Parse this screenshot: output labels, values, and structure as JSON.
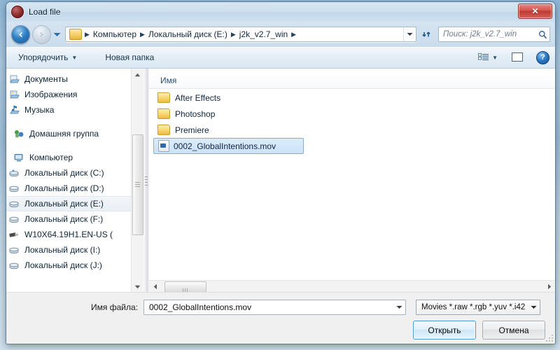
{
  "window": {
    "title": "Load file",
    "app_icon": "record-circle-icon",
    "close_label": "✕"
  },
  "nav": {
    "back_tooltip": "Назад",
    "forward_tooltip": "Вперед",
    "recent_tooltip": "Последние страницы",
    "breadcrumbs": [
      "Компьютер",
      "Локальный диск (E:)",
      "j2k_v2.7_win"
    ],
    "refresh_tooltip": "Обновить",
    "search_placeholder": "Поиск: j2k_v2.7_win"
  },
  "toolbar": {
    "organize_label": "Упорядочить",
    "new_folder_label": "Новая папка",
    "view_tooltip": "Изменить представление",
    "preview_tooltip": "Область предварительного просмотра",
    "help_label": "?"
  },
  "sidebar": {
    "items": [
      {
        "label": "Документы",
        "icon": "document-library-icon",
        "type": "library",
        "selected": false
      },
      {
        "label": "Изображения",
        "icon": "pictures-library-icon",
        "type": "library",
        "selected": false
      },
      {
        "label": "Музыка",
        "icon": "music-library-icon",
        "type": "library",
        "selected": false
      },
      {
        "label": "Домашняя группа",
        "icon": "homegroup-icon",
        "type": "group",
        "selected": false
      },
      {
        "label": "Компьютер",
        "icon": "computer-icon",
        "type": "group",
        "selected": false
      },
      {
        "label": "Локальный диск (C:)",
        "icon": "system-drive-icon",
        "type": "drive",
        "selected": false
      },
      {
        "label": "Локальный диск (D:)",
        "icon": "drive-icon",
        "type": "drive",
        "selected": false
      },
      {
        "label": "Локальный диск (E:)",
        "icon": "drive-icon",
        "type": "drive",
        "selected": true
      },
      {
        "label": "Локальный диск (F:)",
        "icon": "drive-icon",
        "type": "drive",
        "selected": false
      },
      {
        "label": "W10X64.19H1.EN-US (",
        "icon": "usb-drive-icon",
        "type": "drive",
        "selected": false
      },
      {
        "label": "Локальный диск (I:)",
        "icon": "drive-icon",
        "type": "drive",
        "selected": false
      },
      {
        "label": "Локальный диск (J:)",
        "icon": "drive-icon",
        "type": "drive",
        "selected": false
      }
    ]
  },
  "filelist": {
    "column_header": "Имя",
    "sort_direction": "ascending",
    "rows": [
      {
        "name": "After Effects",
        "icon": "folder-icon",
        "type": "folder",
        "selected": false
      },
      {
        "name": "Photoshop",
        "icon": "folder-icon",
        "type": "folder",
        "selected": false
      },
      {
        "name": "Premiere",
        "icon": "folder-icon",
        "type": "folder",
        "selected": false
      },
      {
        "name": "0002_GlobalIntentions.mov",
        "icon": "movie-file-icon",
        "type": "file",
        "selected": true
      }
    ]
  },
  "bottom": {
    "filename_label": "Имя файла:",
    "filename_value": "0002_GlobalIntentions.mov",
    "filter_value": "Movies  *.raw *.rgb *.yuv *.i42",
    "open_label": "Открыть",
    "cancel_label": "Отмена"
  },
  "colors": {
    "accent": "#2d78c4",
    "close_red": "#bb3a34",
    "selection_blue": "#cce4f8",
    "selection_border": "#7ab2e0",
    "folder_yellow": "#eabb45"
  }
}
